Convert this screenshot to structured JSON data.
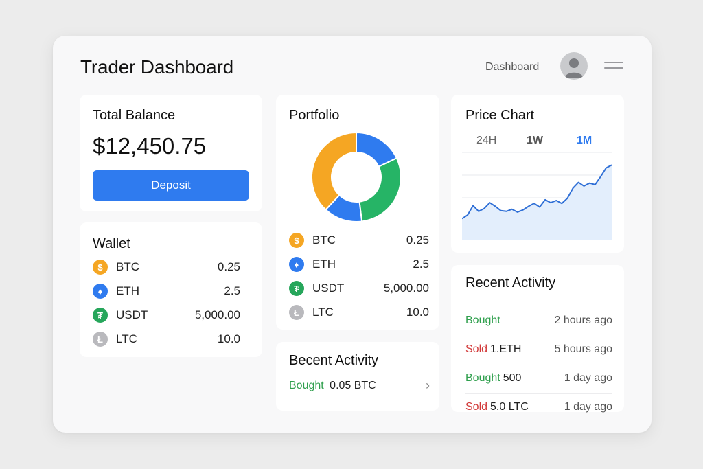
{
  "header": {
    "title": "Trader Dashboard",
    "nav_link": "Dashboard"
  },
  "balance": {
    "title": "Total Balance",
    "amount": "$12,450.75",
    "deposit_label": "Deposit"
  },
  "wallet": {
    "title": "Wallet",
    "assets": [
      {
        "symbol": "BTC",
        "amount": "0.25",
        "icon": "bitcoin-icon",
        "glyph": "$",
        "color": "#f5a623"
      },
      {
        "symbol": "ETH",
        "amount": "2.5",
        "icon": "ethereum-icon",
        "glyph": "♦",
        "color": "#2f7bef"
      },
      {
        "symbol": "USDT",
        "amount": "5,000.00",
        "icon": "tether-icon",
        "glyph": "₮",
        "color": "#26a65b"
      },
      {
        "symbol": "LTC",
        "amount": "10.0",
        "icon": "litecoin-icon",
        "glyph": "Ł",
        "color": "#b9b9bd"
      }
    ]
  },
  "portfolio": {
    "title": "Portfolio",
    "assets": [
      {
        "symbol": "BTC",
        "amount": "0.25",
        "icon": "bitcoin-icon",
        "glyph": "$",
        "color": "#f5a623"
      },
      {
        "symbol": "ETH",
        "amount": "2.5",
        "icon": "ethereum-icon",
        "glyph": "♦",
        "color": "#2f7bef"
      },
      {
        "symbol": "USDT",
        "amount": "5,000.00",
        "icon": "tether-icon",
        "glyph": "₮",
        "color": "#26a65b"
      },
      {
        "symbol": "LTC",
        "amount": "10.0",
        "icon": "litecoin-icon",
        "glyph": "Ł",
        "color": "#b9b9bd"
      }
    ],
    "donut_segments": [
      {
        "name": "BTC",
        "share": 0.38,
        "color": "#f5a623"
      },
      {
        "name": "ETH",
        "share": 0.18,
        "color": "#2f7bef"
      },
      {
        "name": "USDT",
        "share": 0.3,
        "color": "#26b466"
      },
      {
        "name": "ETH",
        "share": 0.14,
        "color": "#2f7bef"
      }
    ]
  },
  "price_chart": {
    "title": "Price Chart",
    "ranges": [
      "24H",
      "1W",
      "1M"
    ],
    "active_range": "1M",
    "line_color": "#2f6fd6",
    "fill_color": "#e3eefc",
    "values": [
      30,
      35,
      48,
      40,
      44,
      52,
      47,
      41,
      40,
      43,
      39,
      42,
      47,
      51,
      46,
      56,
      52,
      55,
      51,
      58,
      72,
      80,
      75,
      79,
      77,
      88,
      100,
      104
    ]
  },
  "recent_activity": {
    "title": "Recent Activity",
    "items": [
      {
        "action": "Bought",
        "action_color": "green",
        "detail": "",
        "time": "2 hours ago"
      },
      {
        "action": "Sold",
        "action_color": "red",
        "detail": "1.ETH",
        "time": "5 hours ago"
      },
      {
        "action": "Bought",
        "action_color": "green",
        "detail": "500",
        "time": "1 day ago"
      },
      {
        "action": "Sold",
        "action_color": "red",
        "detail": "5.0 LTC",
        "time": "1 day ago"
      }
    ]
  },
  "recent_activity_small": {
    "title": "Becent Activity",
    "action": "Bought",
    "detail": "0.05 BTC",
    "chevron": "›"
  }
}
